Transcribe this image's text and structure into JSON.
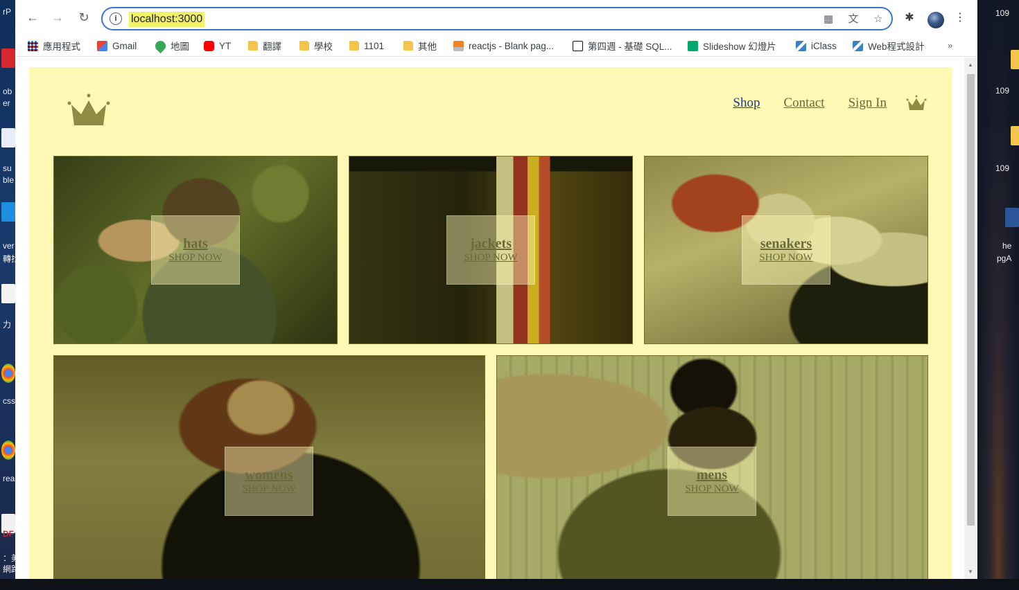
{
  "desktop": {
    "left_snippets": [
      "rP",
      "ob",
      "er",
      "su",
      "ble",
      "ver",
      "轉找",
      "力",
      "css",
      "rea",
      "DF",
      "：美",
      "網路"
    ],
    "right_snippets": [
      "109",
      "109",
      "109",
      "he",
      "pgA"
    ]
  },
  "browser": {
    "url": "localhost:3000",
    "icons": {
      "back": "back-arrow-icon",
      "forward": "forward-arrow-icon",
      "reload": "reload-icon",
      "site_info": "info-icon",
      "qr": "qr-code-icon",
      "translate": "translate-icon",
      "bookmark_star": "star-icon",
      "extensions": "puzzle-icon",
      "menu": "kebab-menu-icon"
    },
    "info_glyph": "i",
    "bookmarks": [
      {
        "label": "應用程式",
        "icon": "apps-grid-icon"
      },
      {
        "label": "Gmail",
        "icon": "gmail-icon"
      },
      {
        "label": "地圖",
        "icon": "maps-pin-icon"
      },
      {
        "label": "YT",
        "icon": "youtube-icon"
      },
      {
        "label": "翻譯",
        "icon": "folder-icon"
      },
      {
        "label": "學校",
        "icon": "folder-icon"
      },
      {
        "label": "1101",
        "icon": "folder-icon"
      },
      {
        "label": "其他",
        "icon": "folder-icon"
      },
      {
        "label": "reactjs - Blank pag...",
        "icon": "stackoverflow-icon"
      },
      {
        "label": "第四週 - 基礎 SQL...",
        "icon": "notion-icon"
      },
      {
        "label": "Slideshow 幻燈片",
        "icon": "w3schools-icon"
      },
      {
        "label": "iClass",
        "icon": "iclass-icon"
      },
      {
        "label": "Web程式設計",
        "icon": "iclass-icon"
      }
    ],
    "more_bookmarks": "»"
  },
  "site": {
    "colors": {
      "background": "#fff9b5",
      "accent": "#6b6b3a",
      "visited_link": "#1a3a9a"
    },
    "logo_icon": "crown-logo-icon",
    "nav": [
      {
        "label": "Shop"
      },
      {
        "label": "Contact"
      },
      {
        "label": "Sign In"
      }
    ],
    "cart_icon": "crown-icon",
    "categories": [
      {
        "title": "hats",
        "cta": "SHOP NOW"
      },
      {
        "title": "jackets",
        "cta": "SHOP NOW"
      },
      {
        "title": "senakers",
        "cta": "SHOP NOW"
      },
      {
        "title": "womens",
        "cta": "SHOP NOW"
      },
      {
        "title": "mens",
        "cta": "SHOP NOW"
      }
    ]
  }
}
